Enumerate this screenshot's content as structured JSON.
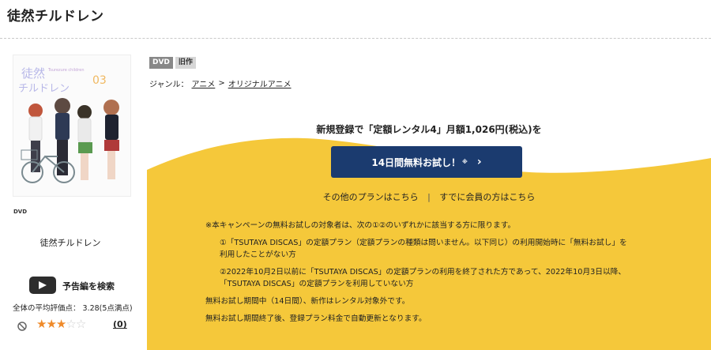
{
  "page": {
    "title": "徒然チルドレン"
  },
  "sidebar": {
    "cover_title": "徒然チルドレン",
    "cover_romaji": "Tsurezure children",
    "cover_volume": "03",
    "dvd_mark": "DVD",
    "item_title": "徒然チルドレン",
    "trailer_label": "予告編を検索",
    "rating_text": "全体の平均評価点： 3.28(5点満点)",
    "rating_value": 3.28,
    "rating_max": 5,
    "review_count": "(0)"
  },
  "badges": [
    "DVD",
    "旧作"
  ],
  "genre": {
    "label": "ジャンル：",
    "crumbs": [
      "アニメ",
      "オリジナルアニメ"
    ],
    "sep": ">"
  },
  "promo": {
    "headline": "新規登録で「定額レンタル4」月額1,026円(税込)を",
    "cta_label": "14日間無料お試し！",
    "cta_sup": "※",
    "other_plans": "その他のプランはこちら",
    "separator": "|",
    "members": "すでに会員の方はこちら",
    "bg_color": "#f5c83a",
    "cta_color": "#1b3b6f"
  },
  "notes": {
    "n1": "※本キャンペーンの無料お試しの対象者は、次の①②のいずれかに該当する方に限ります。",
    "n2a": "①「TSUTAYA DISCAS」の定額プラン（定額プランの種類は問いません。以下同じ）の利用開始時に「無料お試し」を",
    "n2b": "利用したことがない方",
    "n3a": "②2022年10月2日以前に「TSUTAYA DISCAS」の定額プランの利用を終了された方であって、2022年10月3日以降、",
    "n3b": "「TSUTAYA DISCAS」の定額プランを利用していない方",
    "n4": "無料お試し期間中（14日間）、新作はレンタル対象外です。",
    "n5": "無料お試し期間終了後、登録プラン料金で自動更新となります。"
  }
}
